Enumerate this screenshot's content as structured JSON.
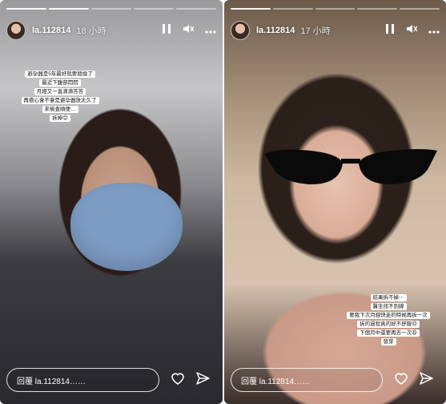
{
  "stories": [
    {
      "username": "la.112814",
      "time_ago": "18 小時",
      "progress": {
        "segments": 5,
        "completed": 2
      },
      "caption": [
        "避孕器是5年最好就要替換了",
        "最近下腹部悶悶",
        "月經又一直滴滴答答",
        "再擔心會不會是避孕器放太久了",
        "來檢查順便…",
        "拆掉😊"
      ],
      "reply_placeholder": "回覆 la.112814……"
    },
    {
      "username": "la.112814",
      "time_ago": "17 小時",
      "progress": {
        "segments": 5,
        "completed": 1
      },
      "caption": [
        "結果拆不掉⋯",
        "醫生找不到線",
        "要我下次月經快走的時候再拆一次",
        "拆的過程真的好不舒服😣",
        "下個月中還要再去一次😩",
        "發芽"
      ],
      "reply_placeholder": "回覆 la.112814……"
    }
  ],
  "icons": {
    "pause": "pause-icon",
    "mute": "mute-icon",
    "more": "more-icon",
    "heart": "heart-icon",
    "share": "share-icon"
  }
}
